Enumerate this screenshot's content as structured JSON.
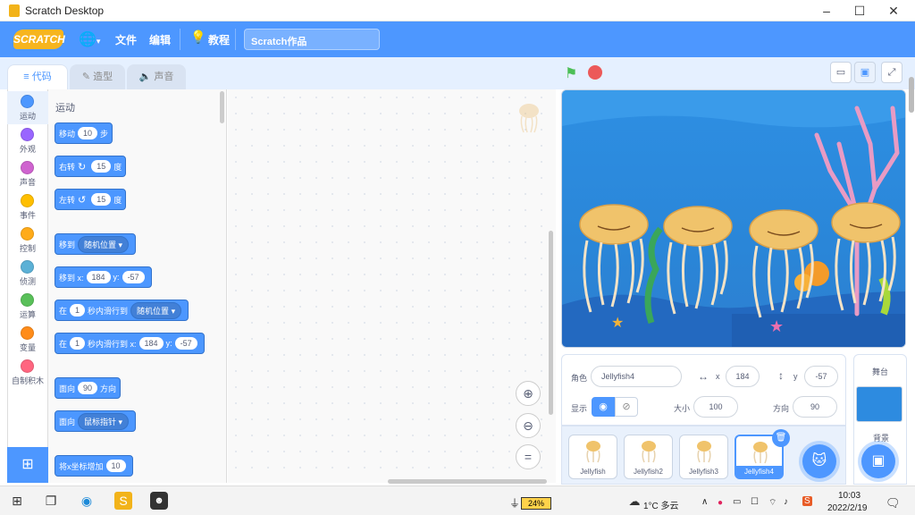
{
  "window": {
    "title": "Scratch Desktop"
  },
  "menubar": {
    "logo": "SCRATCH",
    "file": "文件",
    "edit": "编辑",
    "tutorials": "教程",
    "project_title": "Scratch作品"
  },
  "tabs": [
    {
      "label": "代码"
    },
    {
      "label": "造型"
    },
    {
      "label": "声音"
    }
  ],
  "categories": [
    {
      "label": "运动",
      "color": "#4c97ff"
    },
    {
      "label": "外观",
      "color": "#9966ff"
    },
    {
      "label": "声音",
      "color": "#cf63cf"
    },
    {
      "label": "事件",
      "color": "#ffbf00"
    },
    {
      "label": "控制",
      "color": "#ffab19"
    },
    {
      "label": "侦测",
      "color": "#5cb1d6"
    },
    {
      "label": "运算",
      "color": "#59c059"
    },
    {
      "label": "变量",
      "color": "#ff8c1a"
    },
    {
      "label": "自制积木",
      "color": "#ff6680"
    }
  ],
  "palette": {
    "title": "运动",
    "b1": {
      "t1": "移动",
      "v": "10",
      "t2": "步"
    },
    "b2": {
      "t1": "右转",
      "v": "15",
      "t2": "度"
    },
    "b3": {
      "t1": "左转",
      "v": "15",
      "t2": "度"
    },
    "b4": {
      "t1": "移到",
      "dd": "随机位置"
    },
    "b5": {
      "t1": "移到 x:",
      "x": "184",
      "t2": "y:",
      "y": "-57"
    },
    "b6": {
      "t1": "在",
      "v": "1",
      "t2": "秒内滑行到",
      "dd": "随机位置"
    },
    "b7": {
      "t1": "在",
      "v": "1",
      "t2": "秒内滑行到 x:",
      "x": "184",
      "t3": "y:",
      "y": "-57"
    },
    "b8": {
      "t1": "面向",
      "v": "90",
      "t2": "方向"
    },
    "b9": {
      "t1": "面向",
      "dd": "鼠标指针"
    },
    "b10": {
      "t1": "将x坐标增加",
      "v": "10"
    }
  },
  "sprite_info": {
    "sprite_label": "角色",
    "sprite_name": "Jellyfish4",
    "x_label": "x",
    "x": "184",
    "y_label": "y",
    "y": "-57",
    "show_label": "显示",
    "size_label": "大小",
    "size": "100",
    "direction_label": "方向",
    "direction": "90"
  },
  "sprites": [
    {
      "name": "Jellyfish"
    },
    {
      "name": "Jellyfish2"
    },
    {
      "name": "Jellyfish3"
    },
    {
      "name": "Jellyfish4"
    }
  ],
  "stage_pane": {
    "title": "舞台",
    "backdrop_label": "背景"
  },
  "taskbar": {
    "battery": "24%",
    "weather": "1°C  多云",
    "time": "10:03",
    "date": "2022/2/19"
  },
  "colors": {
    "accent": "#4d97ff",
    "menubar": "#4d97ff",
    "motion_block": "#4c97ff",
    "stage_water": "#2d8be0"
  }
}
